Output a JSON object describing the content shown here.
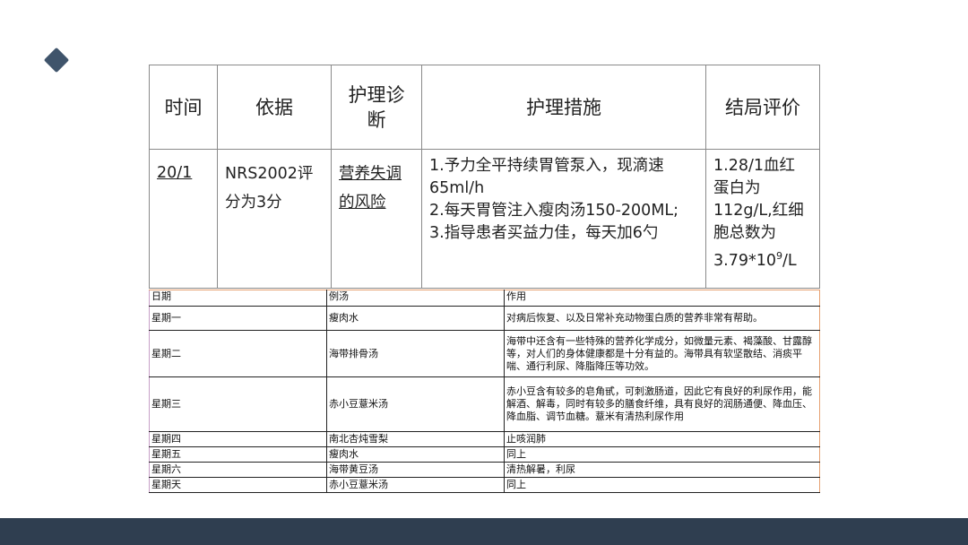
{
  "care_table": {
    "headers": {
      "time": "时间",
      "basis": "依据",
      "diagnosis_line1": "护理诊",
      "diagnosis_line2": "断",
      "measures": "护理措施",
      "evaluation": "结局评价"
    },
    "row": {
      "time": "20/1",
      "basis_line1": "NRS2002评",
      "basis_line2": "分为3分",
      "diagnosis_line1": "营养失调",
      "diagnosis_line2": "的风险",
      "measures": [
        "1.予力全平持续胃管泵入，现滴速",
        "65ml/h",
        "2.每天胃管注入瘦肉汤150-200ML;",
        "3.指导患者买益力佳，每天加6勺"
      ],
      "evaluation_lines": [
        "1.28/1血红",
        "蛋白为",
        "112g/L,红细",
        "胞总数为"
      ],
      "evaluation_last_prefix": "3.79*10",
      "evaluation_last_sup": "9",
      "evaluation_last_suffix": "/L"
    }
  },
  "diet_table": {
    "headers": {
      "day": "日期",
      "soup": "例汤",
      "effect": "作用"
    },
    "rows": [
      {
        "day": "星期一",
        "soup": "瘦肉水",
        "effect": "对病后恢复、以及日常补充动物蛋白质的营养非常有帮助。"
      },
      {
        "day": "星期二",
        "soup": "海带排骨汤",
        "effect": "海带中还含有一些特殊的营养化学成分，如微量元素、褐藻酸、甘露醇等，对人们的身体健康都是十分有益的。海带具有软坚散结、消痰平喘、通行利尿、降脂降压等功效。"
      },
      {
        "day": "星期三",
        "soup": "赤小豆薏米汤",
        "effect": "赤小豆含有较多的皂角甙，可刺激肠道，因此它有良好的利尿作用，能解酒、解毒，同时有较多的膳食纤维，具有良好的润肠通便、降血压、降血脂、调节血糖。薏米有清热利尿作用"
      },
      {
        "day": "星期四",
        "soup": "南北杏炖雪梨",
        "effect": "止咳润肺"
      },
      {
        "day": "星期五",
        "soup": "瘦肉水",
        "effect": "同上"
      },
      {
        "day": "星期六",
        "soup": "海带黄豆汤",
        "effect": "清热解暑，利尿"
      },
      {
        "day": "星期天",
        "soup": "赤小豆薏米汤",
        "effect": "同上"
      }
    ]
  },
  "colors": {
    "accent": "#3f546b",
    "footer": "#2f3e50"
  }
}
